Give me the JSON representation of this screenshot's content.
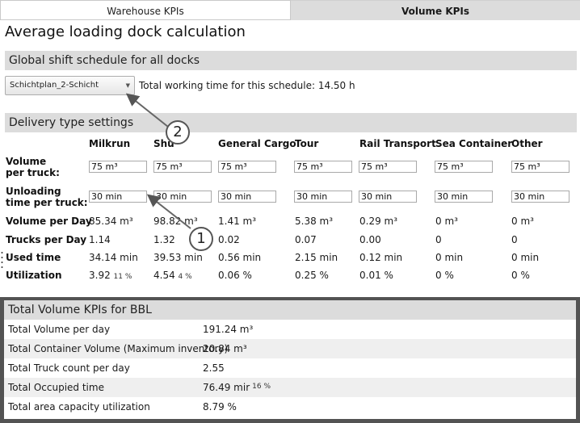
{
  "tabs": [
    {
      "label": "Warehouse KPIs",
      "active": false
    },
    {
      "label": "Volume KPIs",
      "active": true
    }
  ],
  "page_title": "Average loading dock calculation",
  "shift_section": {
    "title": "Global shift schedule for all docks",
    "dropdown_value": "Schichtplan_2-Schicht",
    "info": "Total working time for this schedule: 14.50 h"
  },
  "delivery_section": {
    "title": "Delivery type settings",
    "columns": [
      "Milkrun",
      "Shu",
      "General Cargo",
      "Tour",
      "Rail Transport",
      "Sea Container",
      "Other"
    ],
    "rows": {
      "volume_label_1": "Volume",
      "volume_label_2": "per truck:",
      "unloading_label_1": "Unloading",
      "unloading_label_2": "time per truck:",
      "volume_per_day_label": "Volume per Day",
      "trucks_per_day_label": "Trucks per Day",
      "used_time_label": "Used time",
      "utilization_label": "Utilization"
    },
    "volume_per_truck": [
      "75 m³",
      "75 m³",
      "75 m³",
      "75 m³",
      "75 m³",
      "75 m³",
      "75 m³"
    ],
    "unloading_time": [
      "30 min",
      "30 min",
      "30 min",
      "30 min",
      "30 min",
      "30 min",
      "30 min"
    ],
    "volume_per_day": [
      "85.34 m³",
      "98.82 m³",
      "1.41 m³",
      "5.38 m³",
      "0.29 m³",
      "0 m³",
      "0 m³"
    ],
    "trucks_per_day": [
      "1.14",
      "1.32",
      "0.02",
      "0.07",
      "0.00",
      "0",
      "0"
    ],
    "used_time": [
      "34.14 min",
      "39.53 min",
      "0.56 min",
      "2.15 min",
      "0.12 min",
      "0 min",
      "0 min"
    ],
    "utilization": [
      "3.92",
      "4.54",
      "0.06 %",
      "0.25 %",
      "0.01 %",
      "0 %",
      "0 %"
    ],
    "utilization_ghost": [
      "11 %",
      "4 %"
    ]
  },
  "total_section": {
    "title": "Total Volume KPIs for BBL",
    "rows": [
      {
        "label": "Total Volume per day",
        "value": "191.24 m³"
      },
      {
        "label": "Total Container Volume (Maximum inventory)",
        "value": "20.84 m³"
      },
      {
        "label": "Total Truck count per day",
        "value": "2.55"
      },
      {
        "label": "Total Occupied time",
        "value": "76.49 mir",
        "ghost": "16 %"
      },
      {
        "label": "Total area capacity utilization",
        "value": "8.79 %"
      }
    ]
  },
  "callouts": [
    "1",
    "2"
  ],
  "icons": {
    "dropdown": "chevron-down-icon",
    "resize": "grip-dots-icon"
  },
  "colors": {
    "section_bar": "#dcdcdc",
    "active_tab": "#dcdcdc",
    "panel_border": "#535353",
    "alt_row": "#efefef"
  }
}
